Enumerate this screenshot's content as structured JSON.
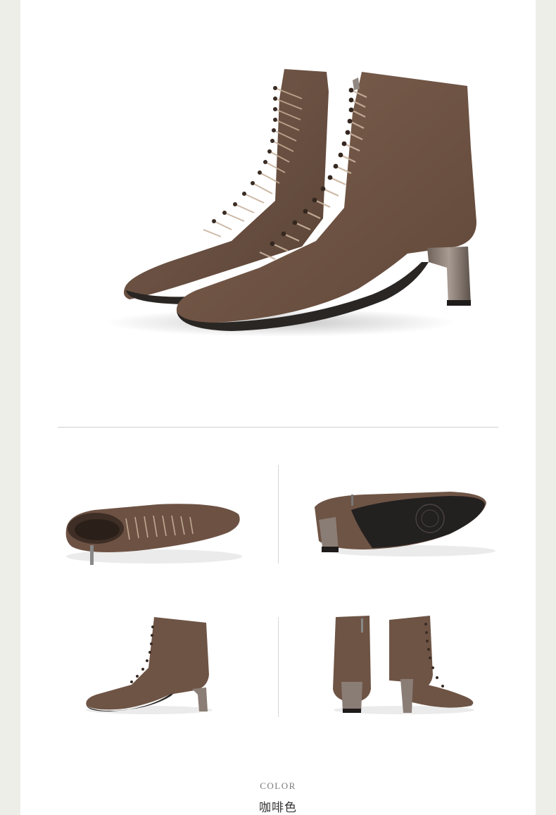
{
  "colors": {
    "suede": "#6e5445",
    "suede_dark": "#4d392e",
    "sole": "#2a2624",
    "heel": "#8a7d75",
    "background_side": "#eeeee9",
    "panel": "#ffffff"
  },
  "images": {
    "hero": "brown-suede-lace-up-ankle-boots-pair",
    "top_view": "boot-top-view",
    "sole_view": "boot-sole-view",
    "side_view": "boot-side-view",
    "back_front_view": "boot-back-and-front-view"
  },
  "caption": {
    "label": "COLOR",
    "value": "咖啡色"
  }
}
